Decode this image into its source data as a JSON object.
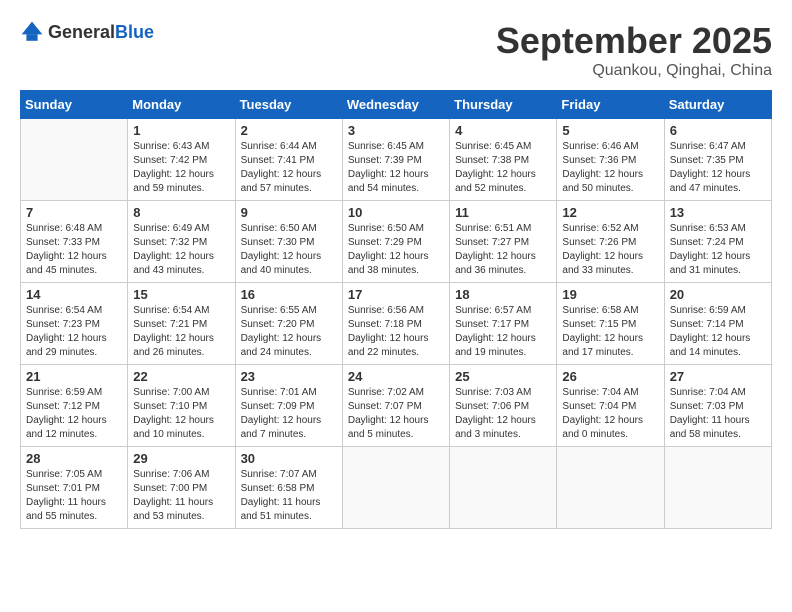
{
  "logo": {
    "general": "General",
    "blue": "Blue"
  },
  "header": {
    "month": "September 2025",
    "location": "Quankou, Qinghai, China"
  },
  "weekdays": [
    "Sunday",
    "Monday",
    "Tuesday",
    "Wednesday",
    "Thursday",
    "Friday",
    "Saturday"
  ],
  "weeks": [
    [
      {
        "day": "",
        "info": ""
      },
      {
        "day": "1",
        "info": "Sunrise: 6:43 AM\nSunset: 7:42 PM\nDaylight: 12 hours\nand 59 minutes."
      },
      {
        "day": "2",
        "info": "Sunrise: 6:44 AM\nSunset: 7:41 PM\nDaylight: 12 hours\nand 57 minutes."
      },
      {
        "day": "3",
        "info": "Sunrise: 6:45 AM\nSunset: 7:39 PM\nDaylight: 12 hours\nand 54 minutes."
      },
      {
        "day": "4",
        "info": "Sunrise: 6:45 AM\nSunset: 7:38 PM\nDaylight: 12 hours\nand 52 minutes."
      },
      {
        "day": "5",
        "info": "Sunrise: 6:46 AM\nSunset: 7:36 PM\nDaylight: 12 hours\nand 50 minutes."
      },
      {
        "day": "6",
        "info": "Sunrise: 6:47 AM\nSunset: 7:35 PM\nDaylight: 12 hours\nand 47 minutes."
      }
    ],
    [
      {
        "day": "7",
        "info": "Sunrise: 6:48 AM\nSunset: 7:33 PM\nDaylight: 12 hours\nand 45 minutes."
      },
      {
        "day": "8",
        "info": "Sunrise: 6:49 AM\nSunset: 7:32 PM\nDaylight: 12 hours\nand 43 minutes."
      },
      {
        "day": "9",
        "info": "Sunrise: 6:50 AM\nSunset: 7:30 PM\nDaylight: 12 hours\nand 40 minutes."
      },
      {
        "day": "10",
        "info": "Sunrise: 6:50 AM\nSunset: 7:29 PM\nDaylight: 12 hours\nand 38 minutes."
      },
      {
        "day": "11",
        "info": "Sunrise: 6:51 AM\nSunset: 7:27 PM\nDaylight: 12 hours\nand 36 minutes."
      },
      {
        "day": "12",
        "info": "Sunrise: 6:52 AM\nSunset: 7:26 PM\nDaylight: 12 hours\nand 33 minutes."
      },
      {
        "day": "13",
        "info": "Sunrise: 6:53 AM\nSunset: 7:24 PM\nDaylight: 12 hours\nand 31 minutes."
      }
    ],
    [
      {
        "day": "14",
        "info": "Sunrise: 6:54 AM\nSunset: 7:23 PM\nDaylight: 12 hours\nand 29 minutes."
      },
      {
        "day": "15",
        "info": "Sunrise: 6:54 AM\nSunset: 7:21 PM\nDaylight: 12 hours\nand 26 minutes."
      },
      {
        "day": "16",
        "info": "Sunrise: 6:55 AM\nSunset: 7:20 PM\nDaylight: 12 hours\nand 24 minutes."
      },
      {
        "day": "17",
        "info": "Sunrise: 6:56 AM\nSunset: 7:18 PM\nDaylight: 12 hours\nand 22 minutes."
      },
      {
        "day": "18",
        "info": "Sunrise: 6:57 AM\nSunset: 7:17 PM\nDaylight: 12 hours\nand 19 minutes."
      },
      {
        "day": "19",
        "info": "Sunrise: 6:58 AM\nSunset: 7:15 PM\nDaylight: 12 hours\nand 17 minutes."
      },
      {
        "day": "20",
        "info": "Sunrise: 6:59 AM\nSunset: 7:14 PM\nDaylight: 12 hours\nand 14 minutes."
      }
    ],
    [
      {
        "day": "21",
        "info": "Sunrise: 6:59 AM\nSunset: 7:12 PM\nDaylight: 12 hours\nand 12 minutes."
      },
      {
        "day": "22",
        "info": "Sunrise: 7:00 AM\nSunset: 7:10 PM\nDaylight: 12 hours\nand 10 minutes."
      },
      {
        "day": "23",
        "info": "Sunrise: 7:01 AM\nSunset: 7:09 PM\nDaylight: 12 hours\nand 7 minutes."
      },
      {
        "day": "24",
        "info": "Sunrise: 7:02 AM\nSunset: 7:07 PM\nDaylight: 12 hours\nand 5 minutes."
      },
      {
        "day": "25",
        "info": "Sunrise: 7:03 AM\nSunset: 7:06 PM\nDaylight: 12 hours\nand 3 minutes."
      },
      {
        "day": "26",
        "info": "Sunrise: 7:04 AM\nSunset: 7:04 PM\nDaylight: 12 hours\nand 0 minutes."
      },
      {
        "day": "27",
        "info": "Sunrise: 7:04 AM\nSunset: 7:03 PM\nDaylight: 11 hours\nand 58 minutes."
      }
    ],
    [
      {
        "day": "28",
        "info": "Sunrise: 7:05 AM\nSunset: 7:01 PM\nDaylight: 11 hours\nand 55 minutes."
      },
      {
        "day": "29",
        "info": "Sunrise: 7:06 AM\nSunset: 7:00 PM\nDaylight: 11 hours\nand 53 minutes."
      },
      {
        "day": "30",
        "info": "Sunrise: 7:07 AM\nSunset: 6:58 PM\nDaylight: 11 hours\nand 51 minutes."
      },
      {
        "day": "",
        "info": ""
      },
      {
        "day": "",
        "info": ""
      },
      {
        "day": "",
        "info": ""
      },
      {
        "day": "",
        "info": ""
      }
    ]
  ]
}
